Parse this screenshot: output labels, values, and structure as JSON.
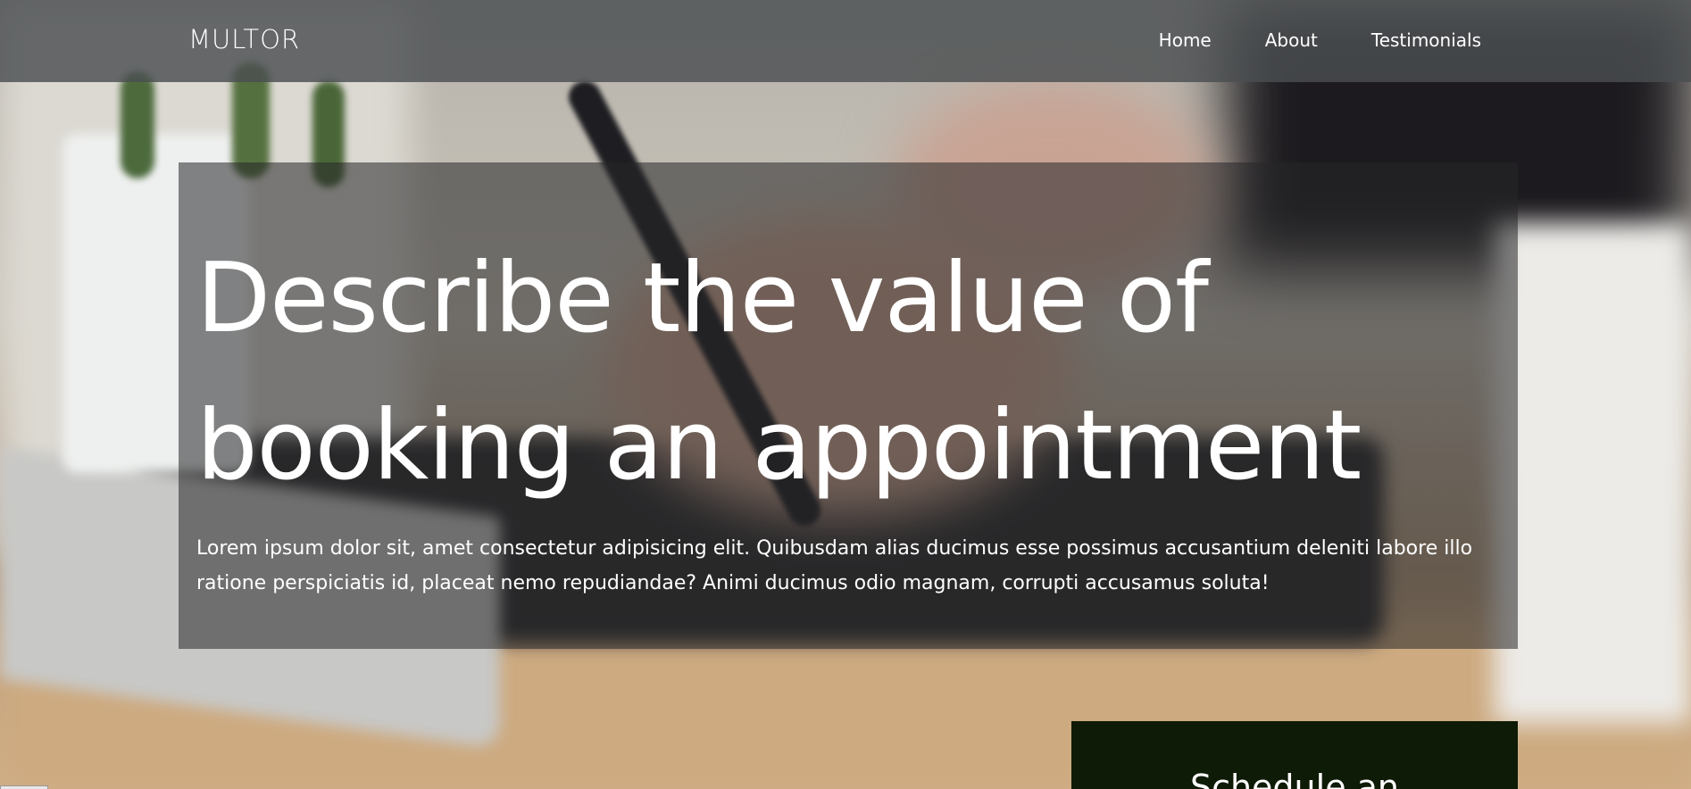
{
  "brand": {
    "logo_text": "MULTOR"
  },
  "nav": {
    "items": [
      {
        "label": "Home"
      },
      {
        "label": "About"
      },
      {
        "label": "Testimonials"
      }
    ]
  },
  "hero": {
    "title": "Describe the value of booking an appointment",
    "body": "Lorem ipsum dolor sit, amet consectetur adipisicing elit. Quibusdam alias ducimus esse possimus accusantium deleniti labore illo ratione perspiciatis id, placeat nemo repudiandae? Animi ducimus odio magnam, corrupti accusamus soluta!"
  },
  "cta": {
    "label": "Schedule an"
  },
  "colors": {
    "header_bg": "#4b4e50",
    "cta_bg": "#0e1b06",
    "text": "#ffffff"
  }
}
